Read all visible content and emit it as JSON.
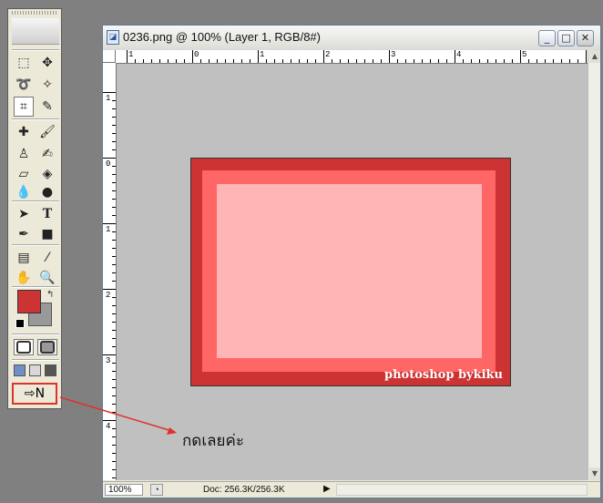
{
  "toolbox": {
    "tools": [
      {
        "name": "marquee-tool",
        "glyph": "⬚"
      },
      {
        "name": "move-tool",
        "glyph": "✥"
      },
      {
        "name": "lasso-tool",
        "glyph": "➰"
      },
      {
        "name": "magic-wand-tool",
        "glyph": "✧"
      },
      {
        "name": "crop-tool",
        "glyph": "⌗"
      },
      {
        "name": "slice-tool",
        "glyph": "✎"
      },
      {
        "name": "healing-brush-tool",
        "glyph": "✚"
      },
      {
        "name": "brush-tool",
        "glyph": "🖌"
      },
      {
        "name": "clone-stamp-tool",
        "glyph": "♙"
      },
      {
        "name": "history-brush-tool",
        "glyph": "✍"
      },
      {
        "name": "eraser-tool",
        "glyph": "▱"
      },
      {
        "name": "paint-bucket-tool",
        "glyph": "◈"
      },
      {
        "name": "blur-tool",
        "glyph": "💧"
      },
      {
        "name": "dodge-tool",
        "glyph": "●"
      },
      {
        "name": "path-selection-tool",
        "glyph": "➤"
      },
      {
        "name": "type-tool",
        "glyph": "T"
      },
      {
        "name": "pen-tool",
        "glyph": "✒"
      },
      {
        "name": "rectangle-tool",
        "glyph": "■"
      },
      {
        "name": "notes-tool",
        "glyph": "▤"
      },
      {
        "name": "eyedropper-tool",
        "glyph": "⁄"
      },
      {
        "name": "hand-tool",
        "glyph": "✋"
      },
      {
        "name": "zoom-tool",
        "glyph": "🔍"
      }
    ],
    "foreground_color": "#cc3333",
    "background_color": "#999999",
    "imageready_glyph": "⇨N",
    "highlight_color": "#e0312b"
  },
  "document": {
    "title": "0236.png @ 100% (Layer 1, RGB/8#)",
    "window_buttons": {
      "minimize": "_",
      "maximize": "□",
      "close": "✕"
    },
    "ruler_top_labels": [
      "1",
      "0",
      "1",
      "2",
      "3",
      "4",
      "5"
    ],
    "ruler_left_labels": [
      "1",
      "0",
      "1",
      "2",
      "3",
      "4"
    ],
    "canvas_color": "#c0c0c0",
    "artwork": {
      "outer_color": "#cc3333",
      "middle_color": "#ff6666",
      "inner_color": "#ffb5b5",
      "watermark": "photoshop bykiku"
    },
    "status": {
      "zoom": "100%",
      "doc_size": "Doc: 256.3K/256.3K",
      "more_arrow": "▶"
    }
  },
  "annotation": {
    "text": "กดเลยค่ะ",
    "arrow_color": "#e0312b"
  }
}
